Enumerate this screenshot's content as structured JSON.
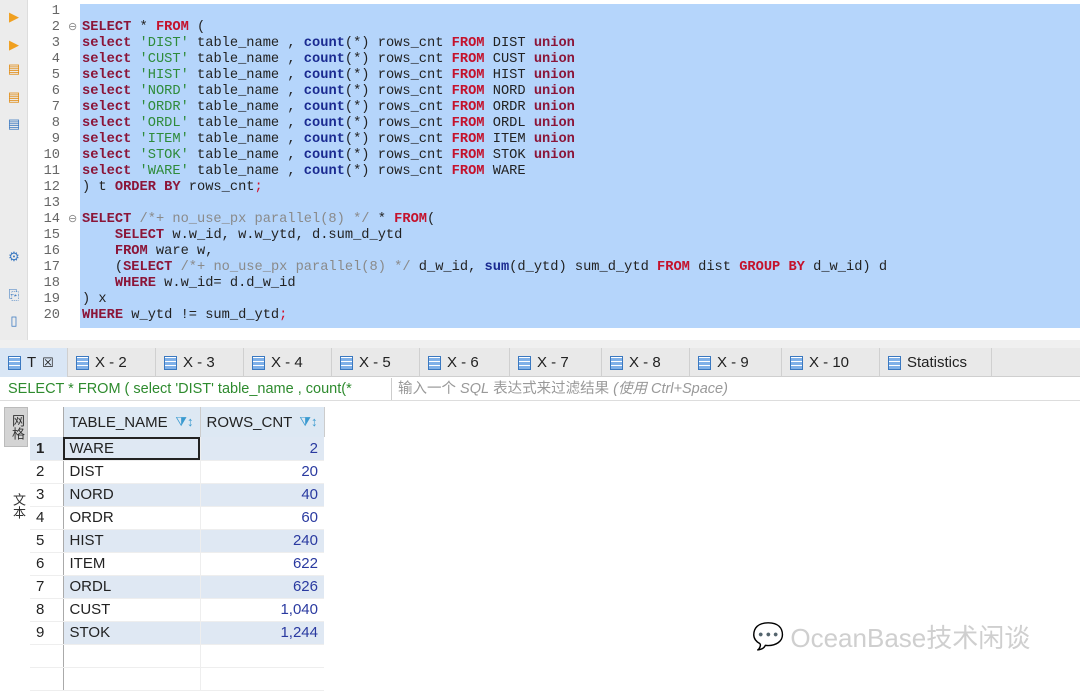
{
  "editor": {
    "lines": [
      [],
      [
        [
          "kw",
          "SELECT"
        ],
        [
          "pl",
          " * "
        ],
        [
          "kw2",
          "FROM"
        ],
        [
          "pl",
          " ("
        ]
      ],
      [
        [
          "kw",
          "select"
        ],
        [
          "str",
          " 'DIST'"
        ],
        [
          "pl",
          " table_name , "
        ],
        [
          "fn",
          "count"
        ],
        [
          "pl",
          "(*) rows_cnt "
        ],
        [
          "kw2",
          "FROM"
        ],
        [
          "pl",
          " DIST "
        ],
        [
          "kw",
          "union"
        ]
      ],
      [
        [
          "kw",
          "select"
        ],
        [
          "str",
          " 'CUST'"
        ],
        [
          "pl",
          " table_name , "
        ],
        [
          "fn",
          "count"
        ],
        [
          "pl",
          "(*) rows_cnt "
        ],
        [
          "kw2",
          "FROM"
        ],
        [
          "pl",
          " CUST "
        ],
        [
          "kw",
          "union"
        ]
      ],
      [
        [
          "kw",
          "select"
        ],
        [
          "str",
          " 'HIST'"
        ],
        [
          "pl",
          " table_name , "
        ],
        [
          "fn",
          "count"
        ],
        [
          "pl",
          "(*) rows_cnt "
        ],
        [
          "kw2",
          "FROM"
        ],
        [
          "pl",
          " HIST "
        ],
        [
          "kw",
          "union"
        ]
      ],
      [
        [
          "kw",
          "select"
        ],
        [
          "str",
          " 'NORD'"
        ],
        [
          "pl",
          " table_name , "
        ],
        [
          "fn",
          "count"
        ],
        [
          "pl",
          "(*) rows_cnt "
        ],
        [
          "kw2",
          "FROM"
        ],
        [
          "pl",
          " NORD "
        ],
        [
          "kw",
          "union"
        ]
      ],
      [
        [
          "kw",
          "select"
        ],
        [
          "str",
          " 'ORDR'"
        ],
        [
          "pl",
          " table_name , "
        ],
        [
          "fn",
          "count"
        ],
        [
          "pl",
          "(*) rows_cnt "
        ],
        [
          "kw2",
          "FROM"
        ],
        [
          "pl",
          " ORDR "
        ],
        [
          "kw",
          "union"
        ]
      ],
      [
        [
          "kw",
          "select"
        ],
        [
          "str",
          " 'ORDL'"
        ],
        [
          "pl",
          " table_name , "
        ],
        [
          "fn",
          "count"
        ],
        [
          "pl",
          "(*) rows_cnt "
        ],
        [
          "kw2",
          "FROM"
        ],
        [
          "pl",
          " ORDL "
        ],
        [
          "kw",
          "union"
        ]
      ],
      [
        [
          "kw",
          "select"
        ],
        [
          "str",
          " 'ITEM'"
        ],
        [
          "pl",
          " table_name , "
        ],
        [
          "fn",
          "count"
        ],
        [
          "pl",
          "(*) rows_cnt "
        ],
        [
          "kw2",
          "FROM"
        ],
        [
          "pl",
          " ITEM "
        ],
        [
          "kw",
          "union"
        ]
      ],
      [
        [
          "kw",
          "select"
        ],
        [
          "str",
          " 'STOK'"
        ],
        [
          "pl",
          " table_name , "
        ],
        [
          "fn",
          "count"
        ],
        [
          "pl",
          "(*) rows_cnt "
        ],
        [
          "kw2",
          "FROM"
        ],
        [
          "pl",
          " STOK "
        ],
        [
          "kw",
          "union"
        ]
      ],
      [
        [
          "kw",
          "select"
        ],
        [
          "str",
          " 'WARE'"
        ],
        [
          "pl",
          " table_name , "
        ],
        [
          "fn",
          "count"
        ],
        [
          "pl",
          "(*) rows_cnt "
        ],
        [
          "kw2",
          "FROM"
        ],
        [
          "pl",
          " WARE"
        ]
      ],
      [
        [
          "pl",
          ") t "
        ],
        [
          "kw",
          "ORDER BY"
        ],
        [
          "pl",
          " rows_cnt"
        ],
        [
          "red",
          ";"
        ]
      ],
      [],
      [
        [
          "kw",
          "SELECT"
        ],
        [
          "cm",
          " /*+ no_use_px parallel(8) */"
        ],
        [
          "pl",
          " * "
        ],
        [
          "kw2",
          "FROM"
        ],
        [
          "pl",
          "("
        ]
      ],
      [
        [
          "pl",
          "    "
        ],
        [
          "kw",
          "SELECT"
        ],
        [
          "pl",
          " w.w_id, w.w_ytd, d.sum_d_ytd"
        ]
      ],
      [
        [
          "pl",
          "    "
        ],
        [
          "kw",
          "FROM"
        ],
        [
          "pl",
          " ware w,"
        ]
      ],
      [
        [
          "pl",
          "    ("
        ],
        [
          "kw",
          "SELECT"
        ],
        [
          "cm",
          " /*+ no_use_px parallel(8) */"
        ],
        [
          "pl",
          " d_w_id, "
        ],
        [
          "fn",
          "sum"
        ],
        [
          "pl",
          "(d_ytd) sum_d_ytd "
        ],
        [
          "kw2",
          "FROM"
        ],
        [
          "pl",
          " dist "
        ],
        [
          "kw2",
          "GROUP BY"
        ],
        [
          "pl",
          " d_w_id) d"
        ]
      ],
      [
        [
          "pl",
          "    "
        ],
        [
          "kw",
          "WHERE"
        ],
        [
          "pl",
          " w.w_id= d.d_w_id"
        ]
      ],
      [
        [
          "pl",
          ") x"
        ]
      ],
      [
        [
          "kw",
          "WHERE"
        ],
        [
          "pl",
          " w_ytd != sum_d_ytd"
        ],
        [
          "red",
          ";"
        ]
      ]
    ],
    "fold_lines": [
      2,
      14
    ]
  },
  "tabs": [
    {
      "label": "T",
      "close": "☒"
    },
    {
      "label": "X - 2"
    },
    {
      "label": "X - 3"
    },
    {
      "label": "X - 4"
    },
    {
      "label": "X - 5"
    },
    {
      "label": "X - 6"
    },
    {
      "label": "X - 7"
    },
    {
      "label": "X - 8"
    },
    {
      "label": "X - 9"
    },
    {
      "label": "X - 10"
    },
    {
      "label": "Statistics"
    }
  ],
  "filter": {
    "query": "SELECT * FROM ( select 'DIST' table_name , count(*",
    "placeholder_pre": "输入一个 ",
    "placeholder_sql": "SQL",
    "placeholder_mid": " 表达式来过滤结果 ",
    "placeholder_hint": "(使用 Ctrl+Space)"
  },
  "side_tabs": {
    "grid": "网格",
    "text": "文本"
  },
  "grid": {
    "columns": [
      "TABLE_NAME",
      "ROWS_CNT"
    ],
    "rows": [
      {
        "n": "1",
        "name": "WARE",
        "cnt": "2"
      },
      {
        "n": "2",
        "name": "DIST",
        "cnt": "20"
      },
      {
        "n": "3",
        "name": "NORD",
        "cnt": "40"
      },
      {
        "n": "4",
        "name": "ORDR",
        "cnt": "60"
      },
      {
        "n": "5",
        "name": "HIST",
        "cnt": "240"
      },
      {
        "n": "6",
        "name": "ITEM",
        "cnt": "622"
      },
      {
        "n": "7",
        "name": "ORDL",
        "cnt": "626"
      },
      {
        "n": "8",
        "name": "CUST",
        "cnt": "1,040"
      },
      {
        "n": "9",
        "name": "STOK",
        "cnt": "1,244"
      }
    ]
  },
  "watermark": "OceanBase技术闲谈"
}
